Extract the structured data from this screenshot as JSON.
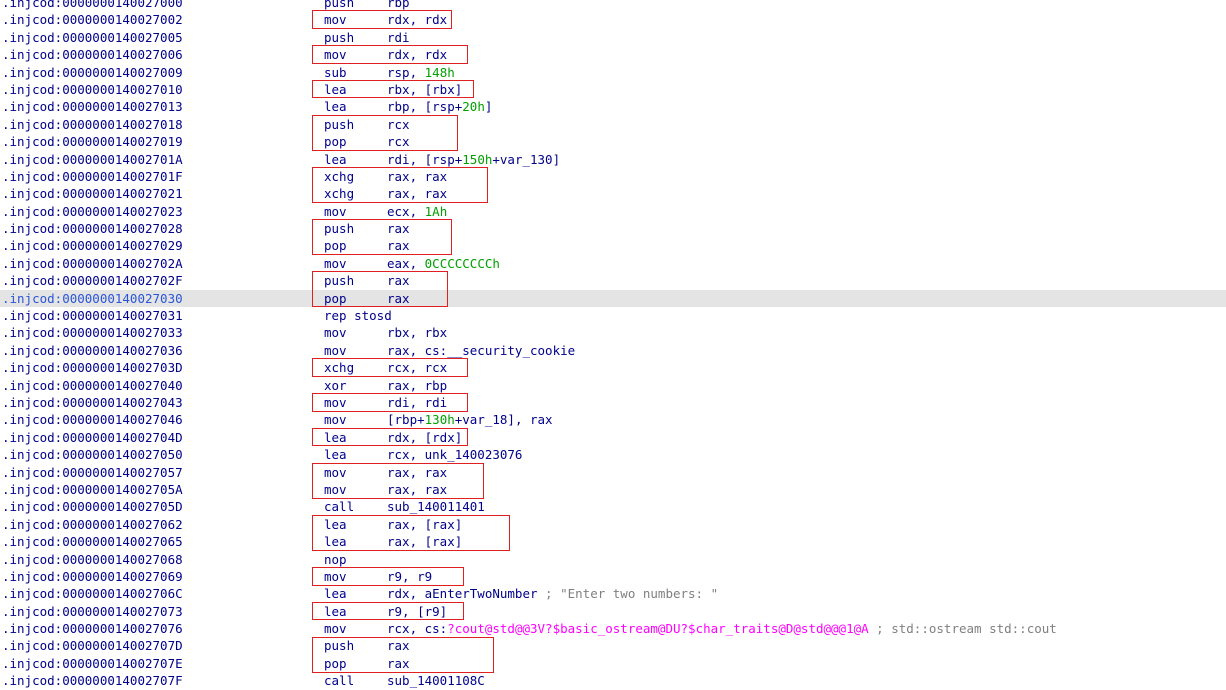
{
  "colors": {
    "code": "#00008b",
    "number": "#00a000",
    "import": "#ff00ff",
    "comment": "#808080",
    "highlight_box": "#e02020",
    "selected_row_bg": "#e4e4e4",
    "selected_address": "#2a55d8"
  },
  "selected_index": 17,
  "lines": [
    {
      "addr": ".injcod:0000000140027000",
      "mn": "push",
      "ops": [
        {
          "t": "rbp"
        }
      ]
    },
    {
      "addr": ".injcod:0000000140027002",
      "mn": "mov",
      "ops": [
        {
          "t": "rdx, rdx"
        }
      ]
    },
    {
      "addr": ".injcod:0000000140027005",
      "mn": "push",
      "ops": [
        {
          "t": "rdi"
        }
      ]
    },
    {
      "addr": ".injcod:0000000140027006",
      "mn": "mov",
      "ops": [
        {
          "t": "rdx, rdx"
        }
      ]
    },
    {
      "addr": ".injcod:0000000140027009",
      "mn": "sub",
      "ops": [
        {
          "t": "rsp, "
        },
        {
          "t": "148h",
          "c": "num"
        }
      ]
    },
    {
      "addr": ".injcod:0000000140027010",
      "mn": "lea",
      "ops": [
        {
          "t": "rbx, [rbx]"
        }
      ]
    },
    {
      "addr": ".injcod:0000000140027013",
      "mn": "lea",
      "ops": [
        {
          "t": "rbp, [rsp+"
        },
        {
          "t": "20h",
          "c": "num"
        },
        {
          "t": "]"
        }
      ]
    },
    {
      "addr": ".injcod:0000000140027018",
      "mn": "push",
      "ops": [
        {
          "t": "rcx"
        }
      ]
    },
    {
      "addr": ".injcod:0000000140027019",
      "mn": "pop",
      "ops": [
        {
          "t": "rcx"
        }
      ]
    },
    {
      "addr": ".injcod:000000014002701A",
      "mn": "lea",
      "ops": [
        {
          "t": "rdi, [rsp+"
        },
        {
          "t": "150h",
          "c": "num"
        },
        {
          "t": "+var_130]"
        }
      ]
    },
    {
      "addr": ".injcod:000000014002701F",
      "mn": "xchg",
      "ops": [
        {
          "t": "rax, rax"
        }
      ]
    },
    {
      "addr": ".injcod:0000000140027021",
      "mn": "xchg",
      "ops": [
        {
          "t": "rax, rax"
        }
      ]
    },
    {
      "addr": ".injcod:0000000140027023",
      "mn": "mov",
      "ops": [
        {
          "t": "ecx, "
        },
        {
          "t": "1Ah",
          "c": "num"
        }
      ]
    },
    {
      "addr": ".injcod:0000000140027028",
      "mn": "push",
      "ops": [
        {
          "t": "rax"
        }
      ]
    },
    {
      "addr": ".injcod:0000000140027029",
      "mn": "pop",
      "ops": [
        {
          "t": "rax"
        }
      ]
    },
    {
      "addr": ".injcod:000000014002702A",
      "mn": "mov",
      "ops": [
        {
          "t": "eax, "
        },
        {
          "t": "0CCCCCCCCh",
          "c": "num"
        }
      ]
    },
    {
      "addr": ".injcod:000000014002702F",
      "mn": "push",
      "ops": [
        {
          "t": "rax"
        }
      ]
    },
    {
      "addr": ".injcod:0000000140027030",
      "mn": "pop",
      "ops": [
        {
          "t": "rax"
        }
      ]
    },
    {
      "addr": ".injcod:0000000140027031",
      "mn": "rep stosd",
      "ops": []
    },
    {
      "addr": ".injcod:0000000140027033",
      "mn": "mov",
      "ops": [
        {
          "t": "rbx, rbx"
        }
      ]
    },
    {
      "addr": ".injcod:0000000140027036",
      "mn": "mov",
      "ops": [
        {
          "t": "rax, cs:__security_cookie"
        }
      ]
    },
    {
      "addr": ".injcod:000000014002703D",
      "mn": "xchg",
      "ops": [
        {
          "t": "rcx, rcx"
        }
      ]
    },
    {
      "addr": ".injcod:0000000140027040",
      "mn": "xor",
      "ops": [
        {
          "t": "rax, rbp"
        }
      ]
    },
    {
      "addr": ".injcod:0000000140027043",
      "mn": "mov",
      "ops": [
        {
          "t": "rdi, rdi"
        }
      ]
    },
    {
      "addr": ".injcod:0000000140027046",
      "mn": "mov",
      "ops": [
        {
          "t": "[rbp+"
        },
        {
          "t": "130h",
          "c": "num"
        },
        {
          "t": "+var_18], rax"
        }
      ]
    },
    {
      "addr": ".injcod:000000014002704D",
      "mn": "lea",
      "ops": [
        {
          "t": "rdx, [rdx]"
        }
      ]
    },
    {
      "addr": ".injcod:0000000140027050",
      "mn": "lea",
      "ops": [
        {
          "t": "rcx, unk_140023076"
        }
      ]
    },
    {
      "addr": ".injcod:0000000140027057",
      "mn": "mov",
      "ops": [
        {
          "t": "rax, rax"
        }
      ]
    },
    {
      "addr": ".injcod:000000014002705A",
      "mn": "mov",
      "ops": [
        {
          "t": "rax, rax"
        }
      ]
    },
    {
      "addr": ".injcod:000000014002705D",
      "mn": "call",
      "ops": [
        {
          "t": "sub_140011401"
        }
      ]
    },
    {
      "addr": ".injcod:0000000140027062",
      "mn": "lea",
      "ops": [
        {
          "t": "rax, [rax]"
        }
      ]
    },
    {
      "addr": ".injcod:0000000140027065",
      "mn": "lea",
      "ops": [
        {
          "t": "rax, [rax]"
        }
      ]
    },
    {
      "addr": ".injcod:0000000140027068",
      "mn": "nop",
      "ops": []
    },
    {
      "addr": ".injcod:0000000140027069",
      "mn": "mov",
      "ops": [
        {
          "t": "r9, r9"
        }
      ]
    },
    {
      "addr": ".injcod:000000014002706C",
      "mn": "lea",
      "ops": [
        {
          "t": "rdx, aEnterTwoNumber "
        },
        {
          "t": "; \"Enter two numbers: \"",
          "c": "cmt"
        }
      ]
    },
    {
      "addr": ".injcod:0000000140027073",
      "mn": "lea",
      "ops": [
        {
          "t": "r9, [r9]"
        }
      ]
    },
    {
      "addr": ".injcod:0000000140027076",
      "mn": "mov",
      "ops": [
        {
          "t": "rcx, cs:"
        },
        {
          "t": "?cout@std@@3V?$basic_ostream@DU?$char_traits@D@std@@@1@A",
          "c": "ext"
        },
        {
          "t": " ; std::ostream std::cout",
          "c": "cmt"
        }
      ]
    },
    {
      "addr": ".injcod:000000014002707D",
      "mn": "push",
      "ops": [
        {
          "t": "rax"
        }
      ]
    },
    {
      "addr": ".injcod:000000014002707E",
      "mn": "pop",
      "ops": [
        {
          "t": "rax"
        }
      ]
    },
    {
      "addr": ".injcod:000000014002707F",
      "mn": "call",
      "ops": [
        {
          "t": "sub_14001108C"
        }
      ]
    }
  ],
  "highlight_groups": [
    {
      "rows": [
        1,
        1
      ],
      "w": 140
    },
    {
      "rows": [
        3,
        3
      ],
      "w": 156
    },
    {
      "rows": [
        5,
        5
      ],
      "w": 162
    },
    {
      "rows": [
        7,
        8
      ],
      "w": 146
    },
    {
      "rows": [
        10,
        11
      ],
      "w": 176
    },
    {
      "rows": [
        13,
        14
      ],
      "w": 140
    },
    {
      "rows": [
        16,
        17
      ],
      "w": 136
    },
    {
      "rows": [
        21,
        21
      ],
      "w": 156
    },
    {
      "rows": [
        23,
        23
      ],
      "w": 156
    },
    {
      "rows": [
        25,
        25
      ],
      "w": 156
    },
    {
      "rows": [
        27,
        28
      ],
      "w": 172
    },
    {
      "rows": [
        30,
        31
      ],
      "w": 198
    },
    {
      "rows": [
        33,
        33
      ],
      "w": 152
    },
    {
      "rows": [
        35,
        35
      ],
      "w": 152
    },
    {
      "rows": [
        37,
        38
      ],
      "w": 182
    }
  ]
}
